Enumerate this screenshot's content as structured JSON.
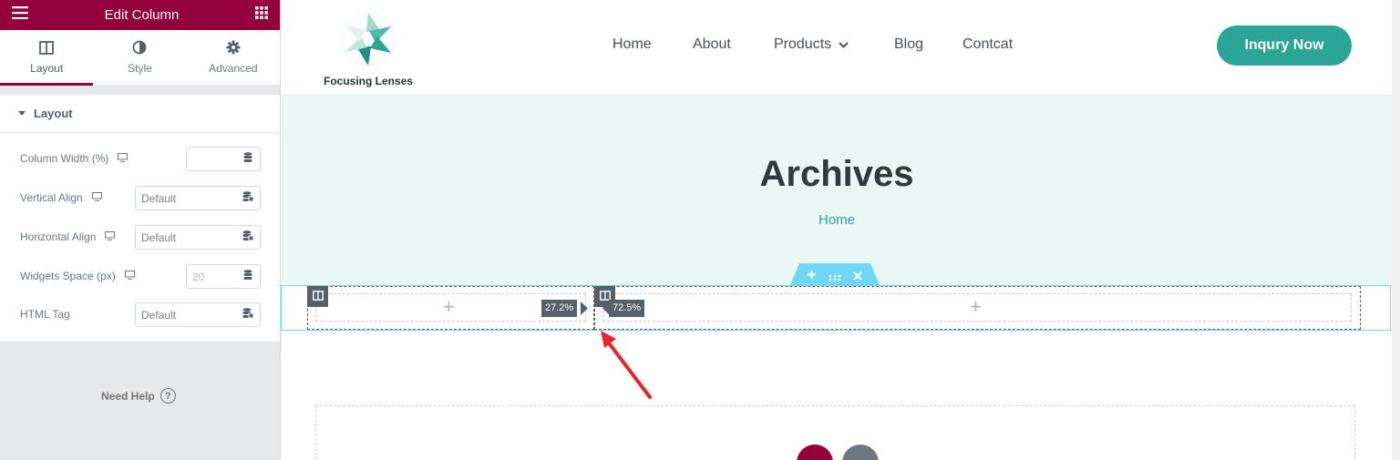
{
  "panel": {
    "title": "Edit Column",
    "tabs": [
      {
        "label": "Layout",
        "icon": "columns-icon",
        "active": true
      },
      {
        "label": "Style",
        "icon": "half-circle-icon",
        "active": false
      },
      {
        "label": "Advanced",
        "icon": "gear-icon",
        "active": false
      }
    ],
    "section_title": "Layout",
    "controls": [
      {
        "label": "Column Width (%)",
        "value": "",
        "placeholder": ""
      },
      {
        "label": "Vertical Align",
        "value": "Default"
      },
      {
        "label": "Horizontal Align",
        "value": "Default"
      },
      {
        "label": "Widgets Space (px)",
        "value": "",
        "placeholder": "20"
      },
      {
        "label": "HTML Tag",
        "value": "Default"
      }
    ],
    "need_help": "Need Help",
    "help_glyph": "?",
    "accent_color": "#93003c"
  },
  "site": {
    "logo_name": "Focusing Lenses",
    "nav": [
      {
        "label": "Home"
      },
      {
        "label": "About"
      },
      {
        "label": "Products",
        "has_dropdown": true
      },
      {
        "label": "Blog"
      },
      {
        "label": "Contcat"
      }
    ],
    "cta_label": "Inqury Now",
    "brand_color": "#2aa596",
    "hero_title": "Archives",
    "breadcrumb": "Home",
    "columns": [
      {
        "width_label": "27.2%"
      },
      {
        "width_label": "72.5%"
      }
    ]
  }
}
